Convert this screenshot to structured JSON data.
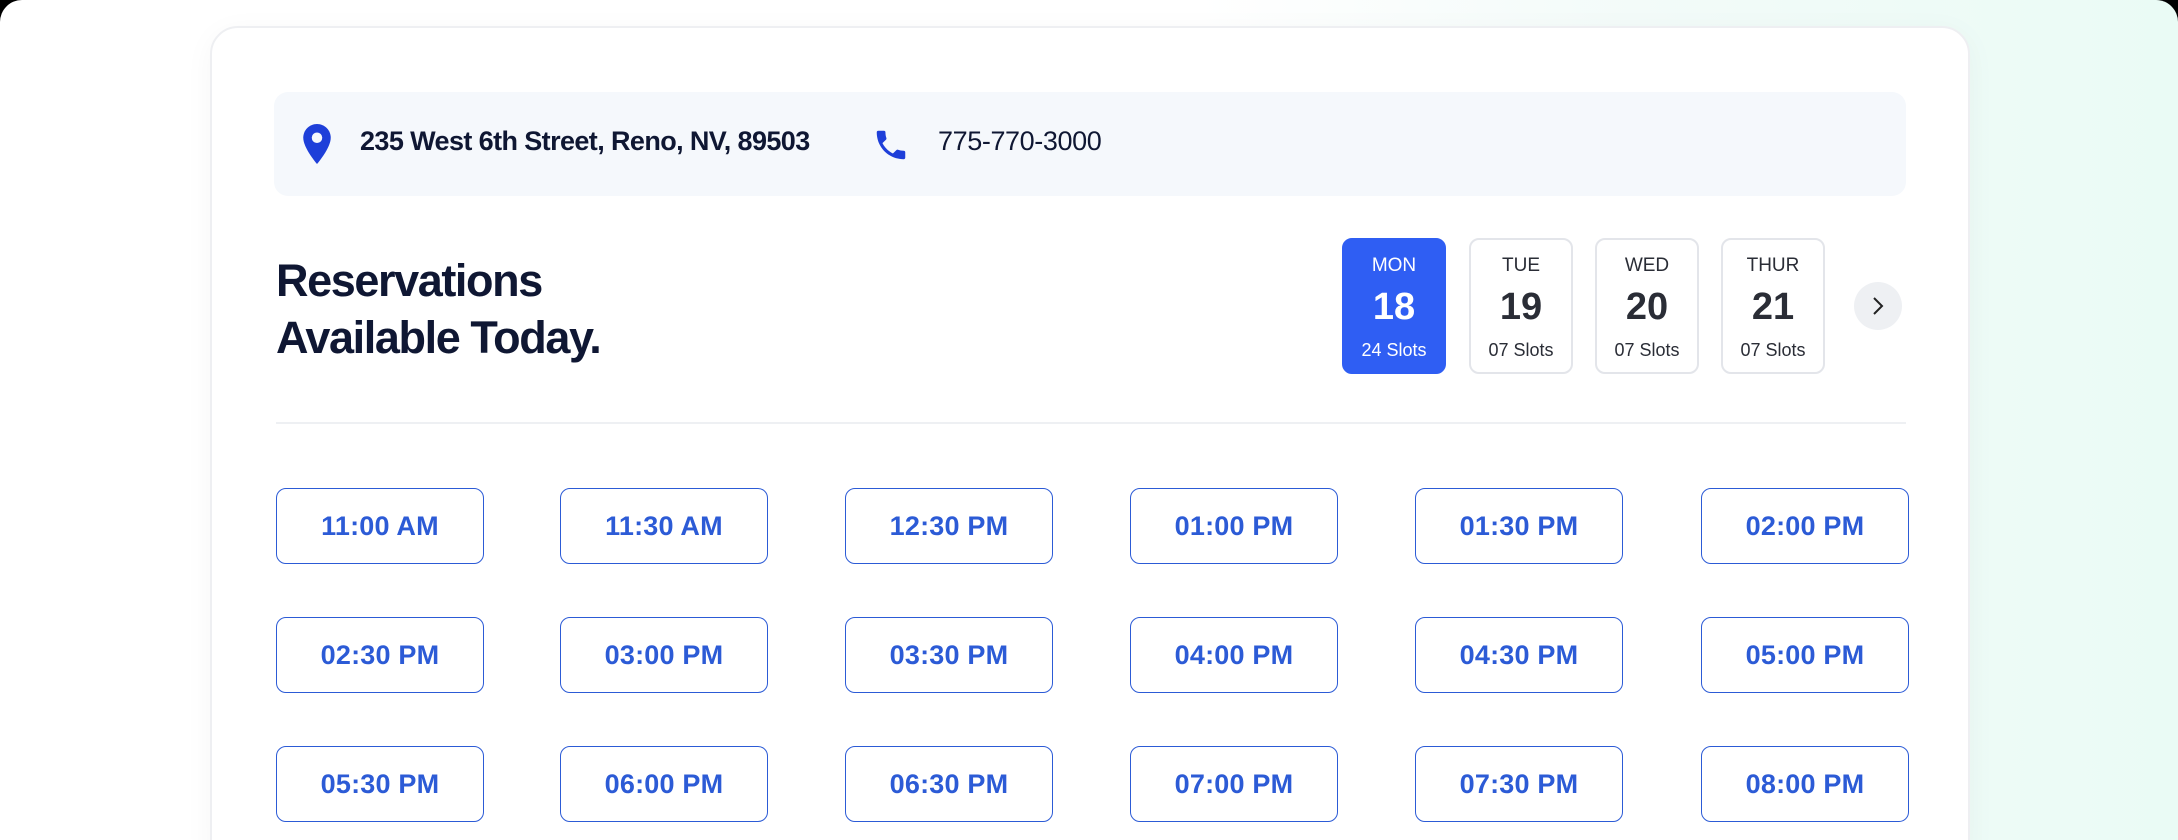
{
  "contact": {
    "address": "235 West 6th Street, Reno, NV, 89503",
    "phone": "775-770-3000",
    "address_icon": "map-pin-icon",
    "phone_icon": "phone-icon"
  },
  "heading": {
    "line1": "Reservations",
    "line2": "Available Today."
  },
  "days": [
    {
      "name": "MON",
      "number": "18",
      "slots": "24 Slots",
      "active": true
    },
    {
      "name": "TUE",
      "number": "19",
      "slots": "07 Slots",
      "active": false
    },
    {
      "name": "WED",
      "number": "20",
      "slots": "07 Slots",
      "active": false
    },
    {
      "name": "THUR",
      "number": "21",
      "slots": "07 Slots",
      "active": false
    }
  ],
  "next_button": {
    "icon": "chevron-right-icon",
    "glyph": ">"
  },
  "time_slots": [
    "11:00 AM",
    "11:30 AM",
    "12:30 PM",
    "01:00 PM",
    "01:30 PM",
    "02:00 PM",
    "02:30 PM",
    "03:00 PM",
    "03:30 PM",
    "04:00 PM",
    "04:30 PM",
    "05:00 PM",
    "05:30 PM",
    "06:00 PM",
    "06:30 PM",
    "07:00 PM",
    "07:30 PM",
    "08:00 PM"
  ],
  "colors": {
    "accent": "#2f5ef3",
    "slot_text": "#2c5bd6",
    "heading": "#0f1733",
    "icon": "#1e3fd9"
  }
}
